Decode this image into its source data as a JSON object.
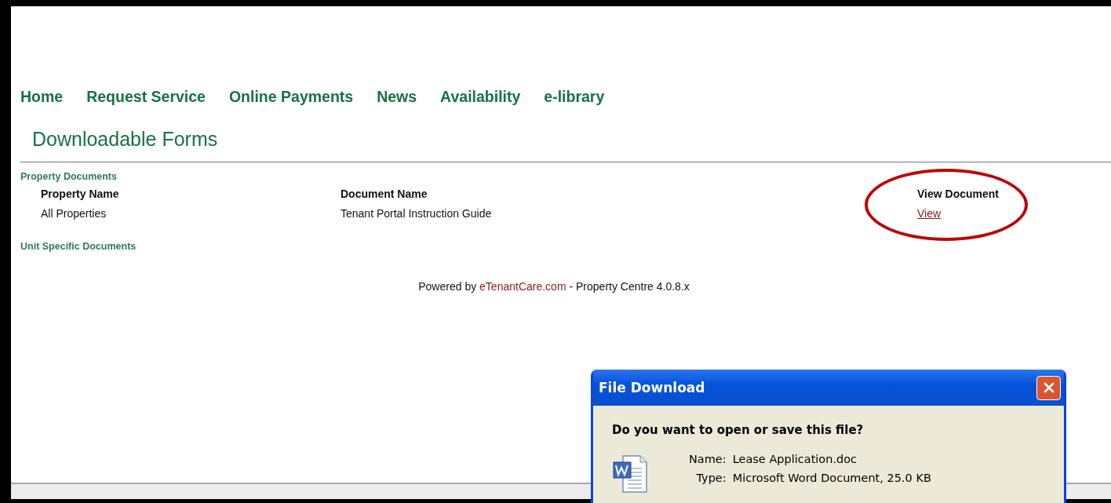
{
  "nav": [
    {
      "label": "Home"
    },
    {
      "label": "Request Service"
    },
    {
      "label": "Online Payments"
    },
    {
      "label": "News"
    },
    {
      "label": "Availability"
    },
    {
      "label": "e-library"
    }
  ],
  "page_title": "Downloadable Forms",
  "sections": [
    {
      "title": "Property Documents",
      "table": {
        "columns": [
          "Property Name",
          "Document Name",
          "View Document"
        ],
        "rows": [
          {
            "cells": [
              "All Properties",
              "Tenant Portal Instruction Guide"
            ],
            "link": "View",
            "circled": true
          }
        ]
      }
    },
    {
      "title": "Unit Specific Documents"
    }
  ],
  "footer": {
    "prefix": "Powered by",
    "link": "eTenantCare.com",
    "suffix": "- Property Centre 4.0.8.x"
  },
  "dialog": {
    "title": "File Download",
    "question": "Do you want to open or save this file?",
    "fields": [
      {
        "label": "Name:",
        "value": "Lease Application.doc"
      },
      {
        "label": "Type:",
        "value": "Microsoft Word Document, 25.0 KB"
      }
    ]
  }
}
